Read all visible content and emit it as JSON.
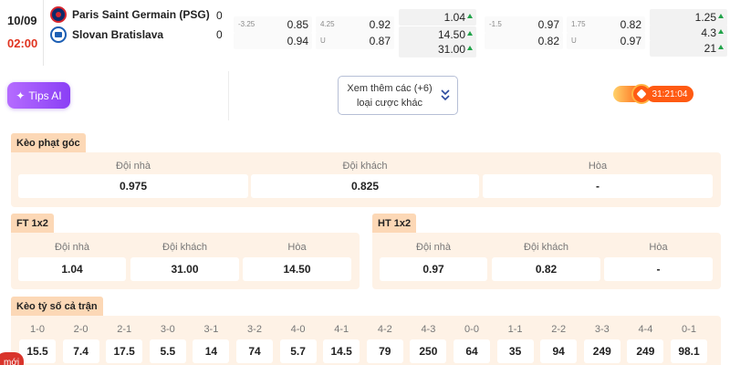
{
  "match": {
    "date": "10/09",
    "time": "02:00",
    "home": {
      "name": "Paris Saint Germain (PSG)",
      "score": "0"
    },
    "away": {
      "name": "Slovan Bratislava",
      "score": "0"
    }
  },
  "odds_strip": {
    "ft_handicap": {
      "home_line": "-3.25",
      "home": "0.85",
      "away": "0.94"
    },
    "ft_overunder": {
      "over_line": "4.25",
      "over": "0.92",
      "under_label": "U",
      "under": "0.87"
    },
    "ft_1x2": [
      "1.04",
      "14.50",
      "31.00"
    ],
    "ht_handicap": {
      "home_line": "-1.5",
      "home": "0.97",
      "away": "0.82"
    },
    "ht_overunder": {
      "over_line": "1.75",
      "over": "0.82",
      "under_label": "U",
      "under": "0.97"
    },
    "ht_1x2": [
      "1.25",
      "4.3",
      "21"
    ]
  },
  "tips_ai": {
    "label": "Tips AI"
  },
  "more_bets": {
    "line1": "Xem thêm các (+6)",
    "line2": "loại cược khác"
  },
  "timer": {
    "value": "31:21:04"
  },
  "corner": {
    "title": "Kèo phạt góc",
    "cols": [
      {
        "label": "Đội nhà",
        "value": "0.975"
      },
      {
        "label": "Đội khách",
        "value": "0.825"
      },
      {
        "label": "Hòa",
        "value": "-"
      }
    ]
  },
  "ft1x2": {
    "title": "FT 1x2",
    "cols": [
      {
        "label": "Đội nhà",
        "value": "1.04"
      },
      {
        "label": "Đội khách",
        "value": "31.00"
      },
      {
        "label": "Hòa",
        "value": "14.50"
      }
    ]
  },
  "ht1x2": {
    "title": "HT 1x2",
    "cols": [
      {
        "label": "Đội nhà",
        "value": "0.97"
      },
      {
        "label": "Đội khách",
        "value": "0.82"
      },
      {
        "label": "Hòa",
        "value": "-"
      }
    ]
  },
  "correct_score": {
    "title": "Kèo tỷ số cả trận",
    "items": [
      {
        "score": "1-0",
        "odd": "15.5"
      },
      {
        "score": "2-0",
        "odd": "7.4"
      },
      {
        "score": "2-1",
        "odd": "17.5"
      },
      {
        "score": "3-0",
        "odd": "5.5"
      },
      {
        "score": "3-1",
        "odd": "14"
      },
      {
        "score": "3-2",
        "odd": "74"
      },
      {
        "score": "4-0",
        "odd": "5.7"
      },
      {
        "score": "4-1",
        "odd": "14.5"
      },
      {
        "score": "4-2",
        "odd": "79"
      },
      {
        "score": "4-3",
        "odd": "250"
      },
      {
        "score": "0-0",
        "odd": "64"
      },
      {
        "score": "1-1",
        "odd": "35"
      },
      {
        "score": "2-2",
        "odd": "94"
      },
      {
        "score": "3-3",
        "odd": "249"
      },
      {
        "score": "4-4",
        "odd": "249"
      },
      {
        "score": "0-1",
        "odd": "98.1"
      }
    ]
  },
  "new_badge": "mới",
  "colors": {
    "accent_orange": "#ff5a12",
    "kickoff_red": "#e0331f",
    "tag_bg": "#fcd8b6",
    "panel_bg": "#fef2e6",
    "up_green": "#22a34a",
    "tips_purple": "#8a3ff5"
  }
}
